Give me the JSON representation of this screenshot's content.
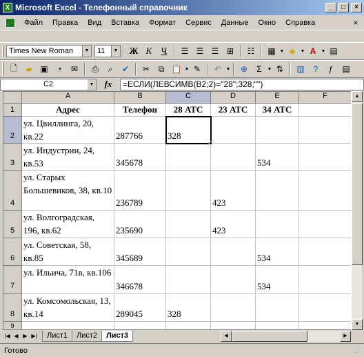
{
  "window": {
    "title": "Microsoft Excel - Телефонный справочник"
  },
  "menu": [
    "Файл",
    "Правка",
    "Вид",
    "Вставка",
    "Формат",
    "Сервис",
    "Данные",
    "Окно",
    "Справка"
  ],
  "format_toolbar": {
    "font": "Times New Roman",
    "size": "11",
    "bold": "Ж",
    "italic": "К",
    "underline": "Ч"
  },
  "formula_bar": {
    "name_box": "C2",
    "fx": "fx",
    "formula": "=ЕСЛИ(ЛЕВСИМВ(B2;2)=\"28\";328;\"\")"
  },
  "sheet": {
    "columns": [
      "A",
      "B",
      "C",
      "D",
      "E",
      "F"
    ],
    "header_row": [
      "Адрес",
      "Телефон",
      "28 АТС",
      "23 АТС",
      "34 АТС",
      ""
    ],
    "rows": [
      {
        "num": "1"
      },
      {
        "num": "2",
        "a": "ул. Цвиллинга, 20, кв.22",
        "b": "287766",
        "c": "328",
        "d": "",
        "e": ""
      },
      {
        "num": "3",
        "a": "ул. Индустрии, 24, кв.53",
        "b": "345678",
        "c": "",
        "d": "",
        "e": "534"
      },
      {
        "num": "4",
        "a": "ул. Старых Большевиков, 38, кв.10",
        "b": "236789",
        "c": "",
        "d": "423",
        "e": ""
      },
      {
        "num": "5",
        "a": "ул. Волгоградская, 196, кв.62",
        "b": "235690",
        "c": "",
        "d": "423",
        "e": ""
      },
      {
        "num": "6",
        "a": "ул. Советская, 58, кв.85",
        "b": "345689",
        "c": "",
        "d": "",
        "e": "534"
      },
      {
        "num": "7",
        "a": "ул. Ильича, 71в, кв.106",
        "b": "346678",
        "c": "",
        "d": "",
        "e": "534"
      },
      {
        "num": "8",
        "a": "ул. Комсомольская, 13, кв.14",
        "b": "289045",
        "c": "328",
        "d": "",
        "e": ""
      },
      {
        "num": "9"
      }
    ]
  },
  "tabs": [
    "Лист1",
    "Лист2",
    "Лист3"
  ],
  "active_tab": "Лист3",
  "status": "Готово"
}
